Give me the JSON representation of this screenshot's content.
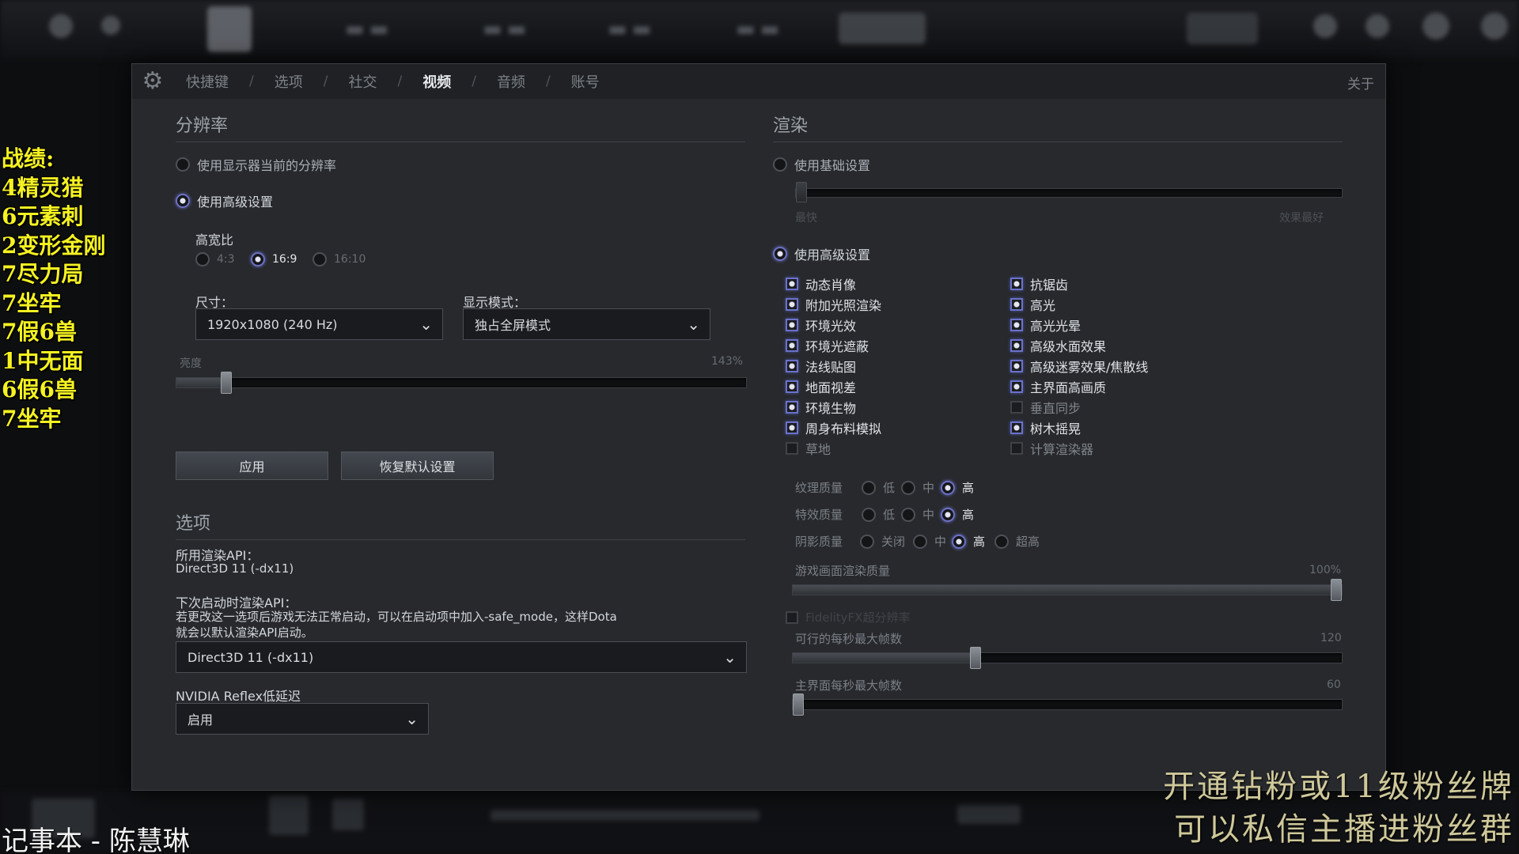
{
  "tabs": [
    "快捷键",
    "选项",
    "社交",
    "视频",
    "音频",
    "账号"
  ],
  "active_tab": "视频",
  "about": "关于",
  "resolution": {
    "title": "分辨率",
    "use_display": "使用显示器当前的分辨率",
    "use_advanced": "使用高级设置",
    "aspect_label": "高宽比",
    "aspect_options": [
      "4:3",
      "16:9",
      "16:10"
    ],
    "aspect_selected": "16:9",
    "size_label": "尺寸：",
    "size_value": "1920x1080 (240 Hz)",
    "mode_label": "显示模式：",
    "mode_value": "独占全屏模式",
    "brightness_label": "亮度",
    "brightness_value": "143%",
    "brightness_level": 0.08,
    "apply": "应用",
    "reset": "恢复默认设置"
  },
  "options": {
    "title": "选项",
    "api_label": "所用渲染API：",
    "api_value": "Direct3D 11 (-dx11)",
    "next_api_label": "下次启动时渲染API：",
    "next_api_note1": "若更改这一选项后游戏无法正常启动，可以在启动项中加入-safe_mode，这样Dota",
    "next_api_note2": "就会以默认渲染API启动。",
    "api_dropdown": "Direct3D 11 (-dx11)",
    "reflex_label": "NVIDIA Reflex低延迟",
    "reflex_value": "启用"
  },
  "render": {
    "title": "渲染",
    "use_basic": "使用基础设置",
    "basic_min": "最快",
    "basic_max": "效果最好",
    "use_advanced": "使用高级设置",
    "checks_left": [
      {
        "label": "动态肖像",
        "on": true
      },
      {
        "label": "附加光照渲染",
        "on": true
      },
      {
        "label": "环境光效",
        "on": true
      },
      {
        "label": "环境光遮蔽",
        "on": true
      },
      {
        "label": "法线贴图",
        "on": true
      },
      {
        "label": "地面视差",
        "on": true
      },
      {
        "label": "环境生物",
        "on": true
      },
      {
        "label": "周身布料模拟",
        "on": true
      },
      {
        "label": "草地",
        "on": false
      }
    ],
    "checks_right": [
      {
        "label": "抗锯齿",
        "on": true
      },
      {
        "label": "高光",
        "on": true
      },
      {
        "label": "高光光晕",
        "on": true
      },
      {
        "label": "高级水面效果",
        "on": true
      },
      {
        "label": "高级迷雾效果/焦散线",
        "on": true
      },
      {
        "label": "主界面高画质",
        "on": true
      },
      {
        "label": "垂直同步",
        "on": false
      },
      {
        "label": "树木摇晃",
        "on": true
      },
      {
        "label": "计算渲染器",
        "on": false
      }
    ],
    "texture_label": "纹理质量",
    "effects_label": "特效质量",
    "shadow_label": "阴影质量",
    "q_low": "低",
    "q_mid": "中",
    "q_high": "高",
    "q_off": "关闭",
    "q_ultra": "超高",
    "render_quality_label": "游戏画面渲染质量",
    "render_quality_value": "100%",
    "render_quality_level": 1.0,
    "fidelity_label": "FidelityFX超分辨率",
    "max_fps_label": "可行的每秒最大帧数",
    "max_fps_value": "120",
    "max_fps_level": 0.33,
    "menu_fps_label": "主界面每秒最大帧数",
    "menu_fps_value": "60",
    "menu_fps_level": 0.0
  },
  "overlay": {
    "stats": [
      "战绩:",
      "4精灵猎",
      "6元素刺",
      "2变形金刚",
      "7尽力局",
      "7坐牢",
      "7假6兽",
      "1中无面",
      "6假6兽",
      "7坐牢"
    ],
    "notepad": "记事本 - 陈慧琳",
    "promo1": "开通钻粉或11级粉丝牌",
    "promo2": "可以私信主播进粉丝群"
  }
}
